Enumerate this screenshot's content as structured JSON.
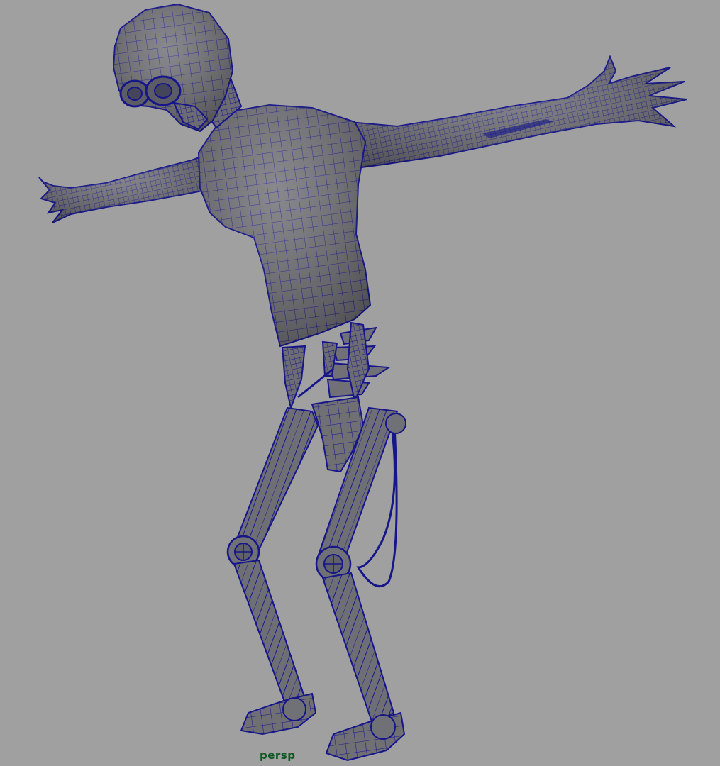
{
  "viewport": {
    "camera_label": "persp",
    "background_color": "#a0a0a0",
    "wireframe_color": "#16158a",
    "shaded_color": "#6e6e73",
    "camera_label_color": "#0b5a23"
  },
  "scene": {
    "object": "character-model",
    "display_mode": "wireframe-on-shaded",
    "icons": [
      "character-mesh-icon"
    ]
  }
}
